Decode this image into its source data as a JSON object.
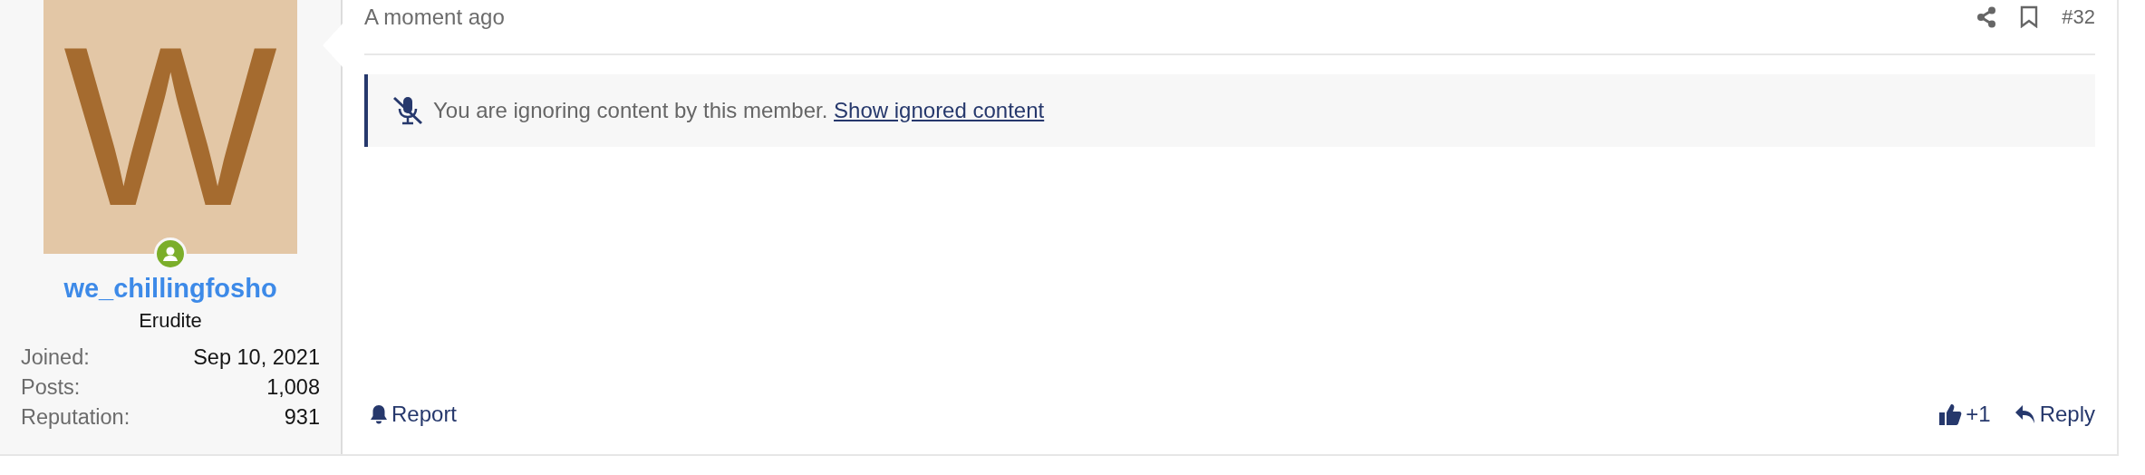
{
  "author": {
    "avatar_letter": "W",
    "online": true,
    "username": "we_chillingfosho",
    "title": "Erudite",
    "stats": [
      {
        "label": "Joined:",
        "value": "Sep 10, 2021"
      },
      {
        "label": "Posts:",
        "value": "1,008"
      },
      {
        "label": "Reputation:",
        "value": "931"
      }
    ]
  },
  "post": {
    "time": "A moment ago",
    "number": "#32",
    "notice": {
      "text": "You are ignoring content by this member.",
      "link": "Show ignored content"
    },
    "report": "Report",
    "like": "+1",
    "reply": "Reply"
  }
}
